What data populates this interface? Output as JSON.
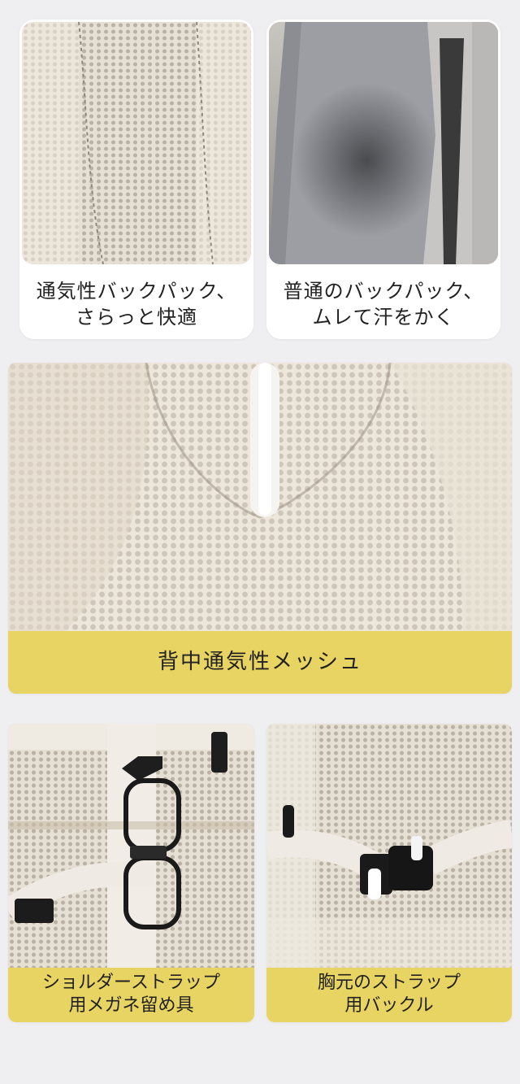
{
  "comparison": {
    "left": {
      "line1": "通気性バックパック、",
      "line2": "さらっと快適"
    },
    "right": {
      "line1": "普通のバックパック、",
      "line2": "ムレて汗をかく"
    }
  },
  "feature_main": {
    "label": "背中通気性メッシュ"
  },
  "features": [
    {
      "line1": "ショルダーストラップ",
      "line2": "用メガネ留め具"
    },
    {
      "line1": "胸元のストラップ",
      "line2": "用バックル"
    }
  ],
  "colors": {
    "banner": "#e8d462",
    "background": "#efeff1",
    "card": "#ffffff"
  }
}
